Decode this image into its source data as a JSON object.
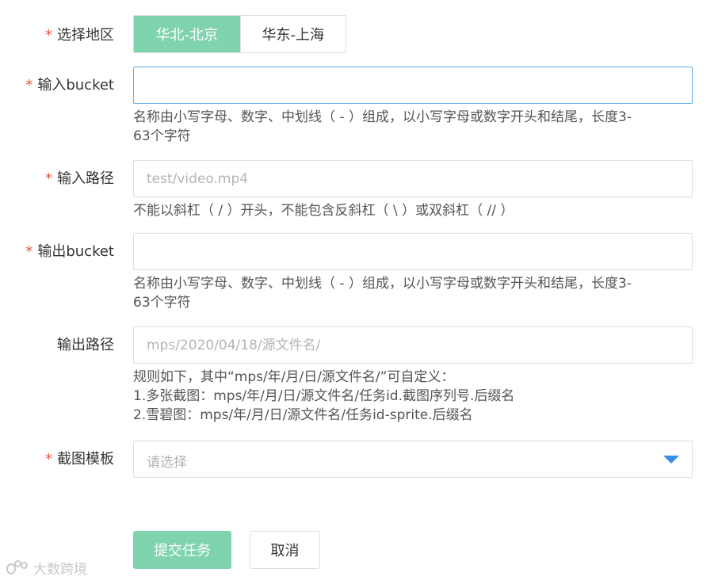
{
  "required_mark": "*",
  "region": {
    "label": "选择地区",
    "options": [
      "华北-北京",
      "华东-上海"
    ],
    "selected": "华北-北京"
  },
  "input_bucket": {
    "label": "输入bucket",
    "value": "",
    "placeholder": "",
    "hint_lines": [
      "名称由小写字母、数字、中划线（ - ）组成，以小写字母或数字开头和结尾，长度3-",
      "63个字符"
    ]
  },
  "input_path": {
    "label": "输入路径",
    "value": "",
    "placeholder": "test/video.mp4",
    "hint_lines": [
      "不能以斜杠（ / ）开头，不能包含反斜杠（ \\ ）或双斜杠（ // ）"
    ]
  },
  "output_bucket": {
    "label": "输出bucket",
    "value": "",
    "placeholder": "",
    "hint_lines": [
      "名称由小写字母、数字、中划线（ - ）组成，以小写字母或数字开头和结尾，长度3-",
      "63个字符"
    ]
  },
  "output_path": {
    "label": "输出路径",
    "value": "",
    "placeholder": "mps/2020/04/18/源文件名/",
    "hint_lines": [
      "规则如下，其中“mps/年/月/日/源文件名/”可自定义：",
      "1.多张截图：mps/年/月/日/源文件名/任务id.截图序列号.后缀名",
      "2.雪碧图：mps/年/月/日/源文件名/任务id-sprite.后缀名"
    ]
  },
  "template": {
    "label": "截图模板",
    "placeholder": "请选择"
  },
  "buttons": {
    "submit": "提交任务",
    "cancel": "取消"
  },
  "watermark": "大数跨境",
  "colors": {
    "accent": "#7fd3ad",
    "required": "#e5553b",
    "focus_border": "#5eb0e5",
    "caret": "#3a8ee6"
  }
}
